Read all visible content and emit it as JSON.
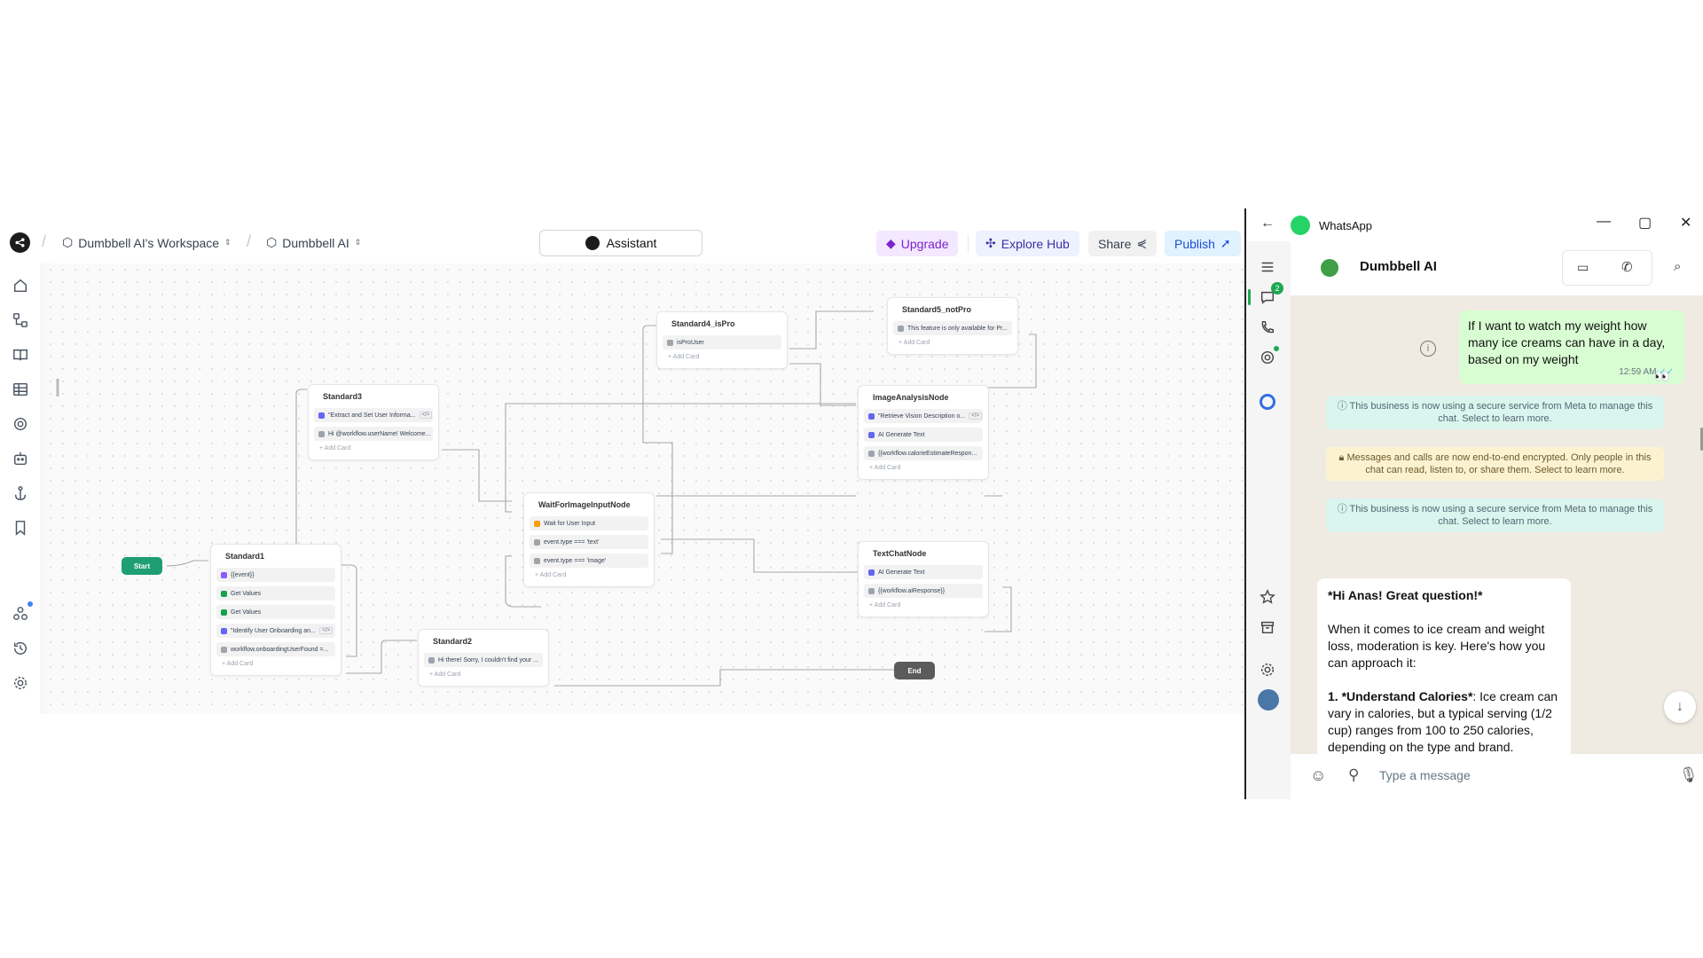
{
  "workflow": {
    "breadcrumbs": [
      {
        "label": "Dumbbell AI's Workspace"
      },
      {
        "label": "Dumbbell AI"
      }
    ],
    "assistant_label": "Assistant",
    "buttons": {
      "upgrade": "Upgrade",
      "explore_hub": "Explore Hub",
      "share": "Share",
      "publish": "Publish"
    },
    "sidebar_icons": [
      "home-icon",
      "workflow-icon",
      "book-icon",
      "table-icon",
      "settings-circle-icon",
      "bot-icon",
      "anchor-icon",
      "bookmark-icon",
      "integrations-icon",
      "history-icon",
      "gear-icon"
    ],
    "nodes": {
      "start": "Start",
      "end": "End",
      "standard1": {
        "title": "Standard1",
        "cards": [
          "{{event}}",
          "Get Values",
          "Get Values",
          "\"Identify User Onboarding an...",
          "workflow.onboardingUserFound =..."
        ],
        "add": "Add Card"
      },
      "standard2": {
        "title": "Standard2",
        "cards": [
          "Hi there! Sorry, I couldn't find your ..."
        ],
        "add": "Add Card"
      },
      "standard3": {
        "title": "Standard3",
        "cards": [
          "\"Extract and Set User Informa...",
          "Hi @workflow.userName! Welcome..."
        ],
        "add": "Add Card"
      },
      "standard4": {
        "title": "Standard4_isPro",
        "cards": [
          "isProUser"
        ],
        "add": "Add Card"
      },
      "standard5": {
        "title": "Standard5_notPro",
        "cards": [
          "This feature is only available for Pr..."
        ],
        "add": "Add Card"
      },
      "image_analysis": {
        "title": "ImageAnalysisNode",
        "cards": [
          "\"Retrieve Vision Description o...",
          "AI Generate Text",
          "{{workflow.calorieEstimateRespon..."
        ],
        "add": "Add Card"
      },
      "wait_image": {
        "title": "WaitForImageInputNode",
        "cards": [
          "Wait for User Input",
          "event.type === 'text'",
          "event.type === 'image'"
        ],
        "add": "Add Card"
      },
      "text_chat": {
        "title": "TextChatNode",
        "cards": [
          "AI Generate Text",
          "{{workflow.aiResponse}}"
        ],
        "add": "Add Card"
      }
    },
    "zoom": {
      "in": "+",
      "out": "−"
    }
  },
  "whatsapp": {
    "app_title": "WhatsApp",
    "chat_name": "Dumbbell AI",
    "unread_badge": "2",
    "outgoing": {
      "text": "If I want to watch my weight how many ice creams can  have in a day, based on  my weight",
      "time": "12:59 AM",
      "reaction": "👀"
    },
    "system_messages": [
      "This business is now using a secure service from Meta to manage this chat. Select to learn more.",
      "Messages and calls are now end-to-end encrypted. Only people in this chat can read, listen to, or share them. Select to learn more.",
      "This business is now using a secure service from Meta to manage this chat. Select to learn more."
    ],
    "incoming": {
      "p1": "*Hi Anas! Great question!*",
      "p2": "When it comes to ice cream and weight loss, moderation is key. Here's how you can approach it:",
      "p3_bold": "1. *Understand Calories*",
      "p3_rest": ": Ice cream can vary in calories, but a typical serving (1/2 cup) ranges from 100 to 250 calories, depending on the type and brand."
    },
    "input_placeholder": "Type a message",
    "colors": {
      "green": "#25d366",
      "bubble_out": "#d9fdd3"
    }
  }
}
